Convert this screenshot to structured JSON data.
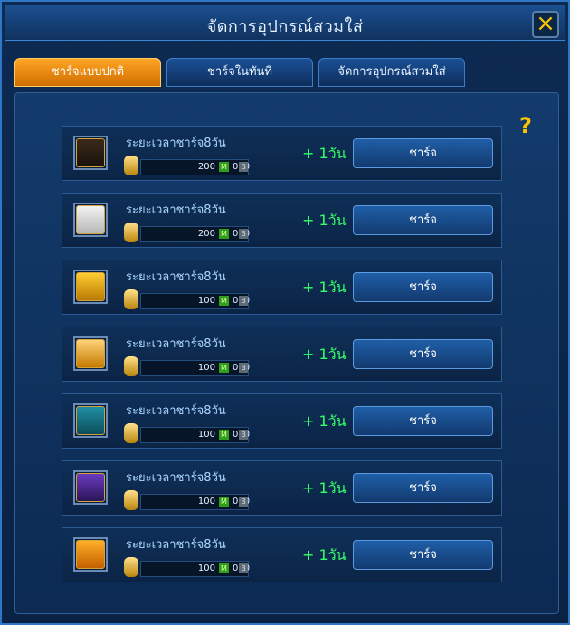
{
  "window": {
    "title": "จัดการอุปกรณ์สวมใส่",
    "close_icon": "close-icon"
  },
  "tabs": [
    {
      "label": "ชาร์จแบบปกติ",
      "active": true
    },
    {
      "label": "ชาร์จในทันที",
      "active": false
    },
    {
      "label": "จัดการอุปกรณ์สวมใส่",
      "active": false
    }
  ],
  "help_icon": "?",
  "rows": [
    {
      "item_icon": "armor-icon",
      "label": "ระยะเวลาชาร์จ8วัน",
      "price_left": "200",
      "badge_m": "M",
      "price_right": "000",
      "badge_b": "B",
      "plus_days": "+ 1วัน",
      "button": "ชาร์จ"
    },
    {
      "item_icon": "glove-icon",
      "label": "ระยะเวลาชาร์จ8วัน",
      "price_left": "200",
      "badge_m": "M",
      "price_right": "000",
      "badge_b": "B",
      "plus_days": "+ 1วัน",
      "button": "ชาร์จ"
    },
    {
      "item_icon": "boots-icon",
      "label": "ระยะเวลาชาร์จ8วัน",
      "price_left": "100",
      "badge_m": "M",
      "price_right": "000",
      "badge_b": "B",
      "plus_days": "+ 1วัน",
      "button": "ชาร์จ"
    },
    {
      "item_icon": "bouquet-icon",
      "label": "ระยะเวลาชาร์จ8วัน",
      "price_left": "100",
      "badge_m": "M",
      "price_right": "000",
      "badge_b": "B",
      "plus_days": "+ 1วัน",
      "button": "ชาร์จ"
    },
    {
      "item_icon": "witch-hat-icon",
      "label": "ระยะเวลาชาร์จ8วัน",
      "price_left": "100",
      "badge_m": "M",
      "price_right": "000",
      "badge_b": "B",
      "plus_days": "+ 1วัน",
      "button": "ชาร์จ"
    },
    {
      "item_icon": "mask-icon",
      "label": "ระยะเวลาชาร์จ8วัน",
      "price_left": "100",
      "badge_m": "M",
      "price_right": "000",
      "badge_b": "B",
      "plus_days": "+ 1วัน",
      "button": "ชาร์จ"
    },
    {
      "item_icon": "shoe-icon",
      "label": "ระยะเวลาชาร์จ8วัน",
      "price_left": "100",
      "badge_m": "M",
      "price_right": "000",
      "badge_b": "B",
      "plus_days": "+ 1วัน",
      "button": "ชาร์จ"
    }
  ]
}
